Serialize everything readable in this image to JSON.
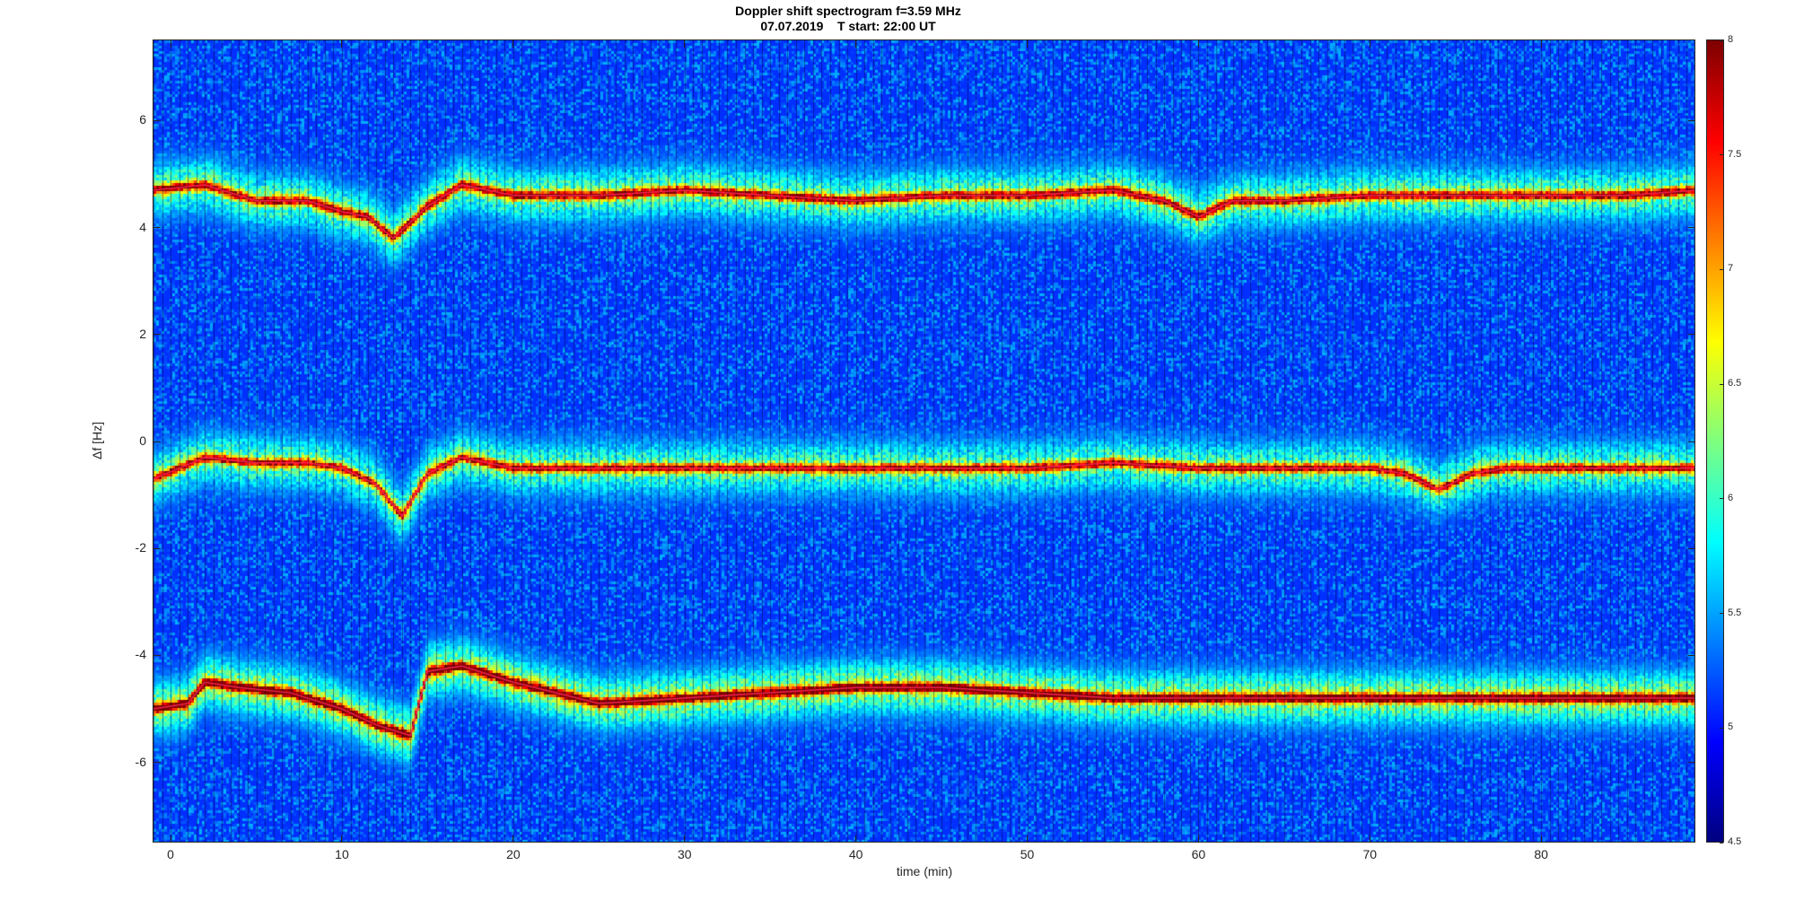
{
  "title": {
    "line1": "Doppler shift spectrogram f=3.59 MHz",
    "line2": "07.07.2019    T start: 22:00 UT"
  },
  "chart_data": {
    "type": "heatmap",
    "title": "Doppler shift spectrogram f=3.59 MHz",
    "subtitle": "07.07.2019    T start: 22:00 UT",
    "xlabel": "time (min)",
    "ylabel": "Δf [Hz]",
    "xlim": [
      -1,
      89
    ],
    "ylim": [
      -7.5,
      7.5
    ],
    "xticks": [
      0,
      10,
      20,
      30,
      40,
      50,
      60,
      70,
      80
    ],
    "yticks": [
      -6,
      -4,
      -2,
      0,
      2,
      4,
      6
    ],
    "colormap": "jet",
    "colorbar": {
      "limits": [
        4.5,
        8
      ],
      "ticks": [
        4.5,
        5,
        5.5,
        6,
        6.5,
        7,
        7.5,
        8
      ]
    },
    "background_level": 5.1,
    "traces": [
      {
        "name": "upper",
        "x": [
          -1,
          2,
          5,
          8,
          10,
          11.5,
          13,
          15,
          17,
          20,
          25,
          30,
          35,
          40,
          45,
          50,
          55,
          58,
          60,
          62,
          65,
          70,
          75,
          80,
          85,
          89
        ],
        "y": [
          4.7,
          4.8,
          4.5,
          4.5,
          4.3,
          4.2,
          3.8,
          4.4,
          4.8,
          4.6,
          4.6,
          4.7,
          4.6,
          4.5,
          4.6,
          4.6,
          4.7,
          4.5,
          4.2,
          4.5,
          4.5,
          4.6,
          4.6,
          4.6,
          4.6,
          4.7
        ],
        "peak": 7.4
      },
      {
        "name": "middle",
        "x": [
          -1,
          2,
          5,
          8,
          10,
          12,
          13.5,
          15,
          17,
          20,
          25,
          30,
          35,
          40,
          45,
          50,
          55,
          60,
          65,
          70,
          72,
          74,
          76,
          78,
          80,
          85,
          89
        ],
        "y": [
          -0.7,
          -0.3,
          -0.4,
          -0.4,
          -0.5,
          -0.8,
          -1.4,
          -0.6,
          -0.3,
          -0.5,
          -0.5,
          -0.5,
          -0.5,
          -0.5,
          -0.5,
          -0.5,
          -0.4,
          -0.5,
          -0.5,
          -0.5,
          -0.6,
          -0.9,
          -0.6,
          -0.5,
          -0.5,
          -0.5,
          -0.5
        ],
        "peak": 7.3
      },
      {
        "name": "lower",
        "x": [
          -1,
          1,
          2,
          4,
          7,
          10,
          12,
          14,
          15,
          17,
          20,
          25,
          30,
          35,
          40,
          45,
          50,
          55,
          60,
          65,
          70,
          75,
          80,
          85,
          89
        ],
        "y": [
          -5.0,
          -4.9,
          -4.5,
          -4.6,
          -4.7,
          -5.0,
          -5.3,
          -5.5,
          -4.3,
          -4.2,
          -4.5,
          -4.9,
          -4.8,
          -4.7,
          -4.6,
          -4.6,
          -4.7,
          -4.8,
          -4.8,
          -4.8,
          -4.8,
          -4.8,
          -4.8,
          -4.8,
          -4.8
        ],
        "peak": 7.8
      }
    ]
  }
}
